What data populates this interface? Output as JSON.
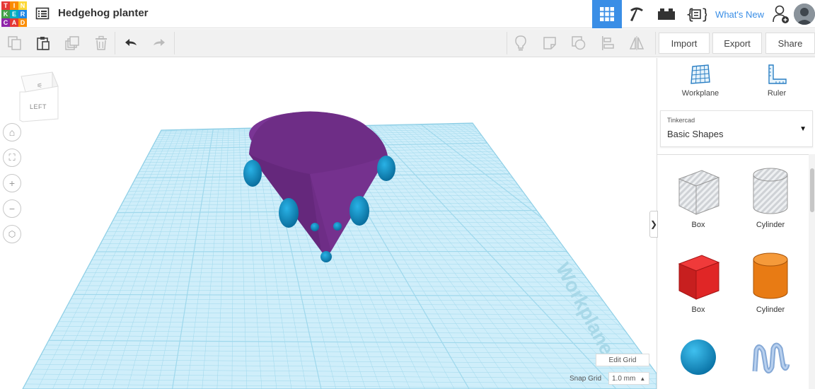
{
  "app": {
    "logo_letters": [
      "T",
      "I",
      "N",
      "K",
      "E",
      "R",
      "C",
      "A",
      "D"
    ],
    "logo_colors": [
      "#e53935",
      "#fb8c00",
      "#fdd835",
      "#43a047",
      "#00acc1",
      "#1e88e5",
      "#8e24aa",
      "#e53935",
      "#fb8c00"
    ],
    "title": "Hedgehog planter",
    "whats_new": "What's New",
    "accent": "#3a8ee6"
  },
  "toolbar": {
    "import": "Import",
    "export": "Export",
    "share": "Share"
  },
  "view_cube": {
    "face": "LEFT"
  },
  "viewport": {
    "workplane_label": "Workplane",
    "edit_grid": "Edit Grid",
    "snap_grid_label": "Snap Grid",
    "snap_grid_value": "1.0 mm",
    "grid_color": "#9fd8ec",
    "object_color": "#6e2d86",
    "accent_shape_color": "#0f8fc4"
  },
  "panel": {
    "tools": [
      {
        "label": "Workplane",
        "icon": "workplane-icon"
      },
      {
        "label": "Ruler",
        "icon": "ruler-icon"
      }
    ],
    "library_source": "Tinkercad",
    "library_name": "Basic Shapes",
    "shapes": [
      {
        "label": "Box",
        "icon": "box-hole-icon"
      },
      {
        "label": "Cylinder",
        "icon": "cylinder-hole-icon"
      },
      {
        "label": "Box",
        "icon": "box-solid-icon"
      },
      {
        "label": "Cylinder",
        "icon": "cylinder-solid-icon"
      },
      {
        "label": "",
        "icon": "sphere-icon"
      },
      {
        "label": "",
        "icon": "scribble-icon"
      }
    ]
  }
}
